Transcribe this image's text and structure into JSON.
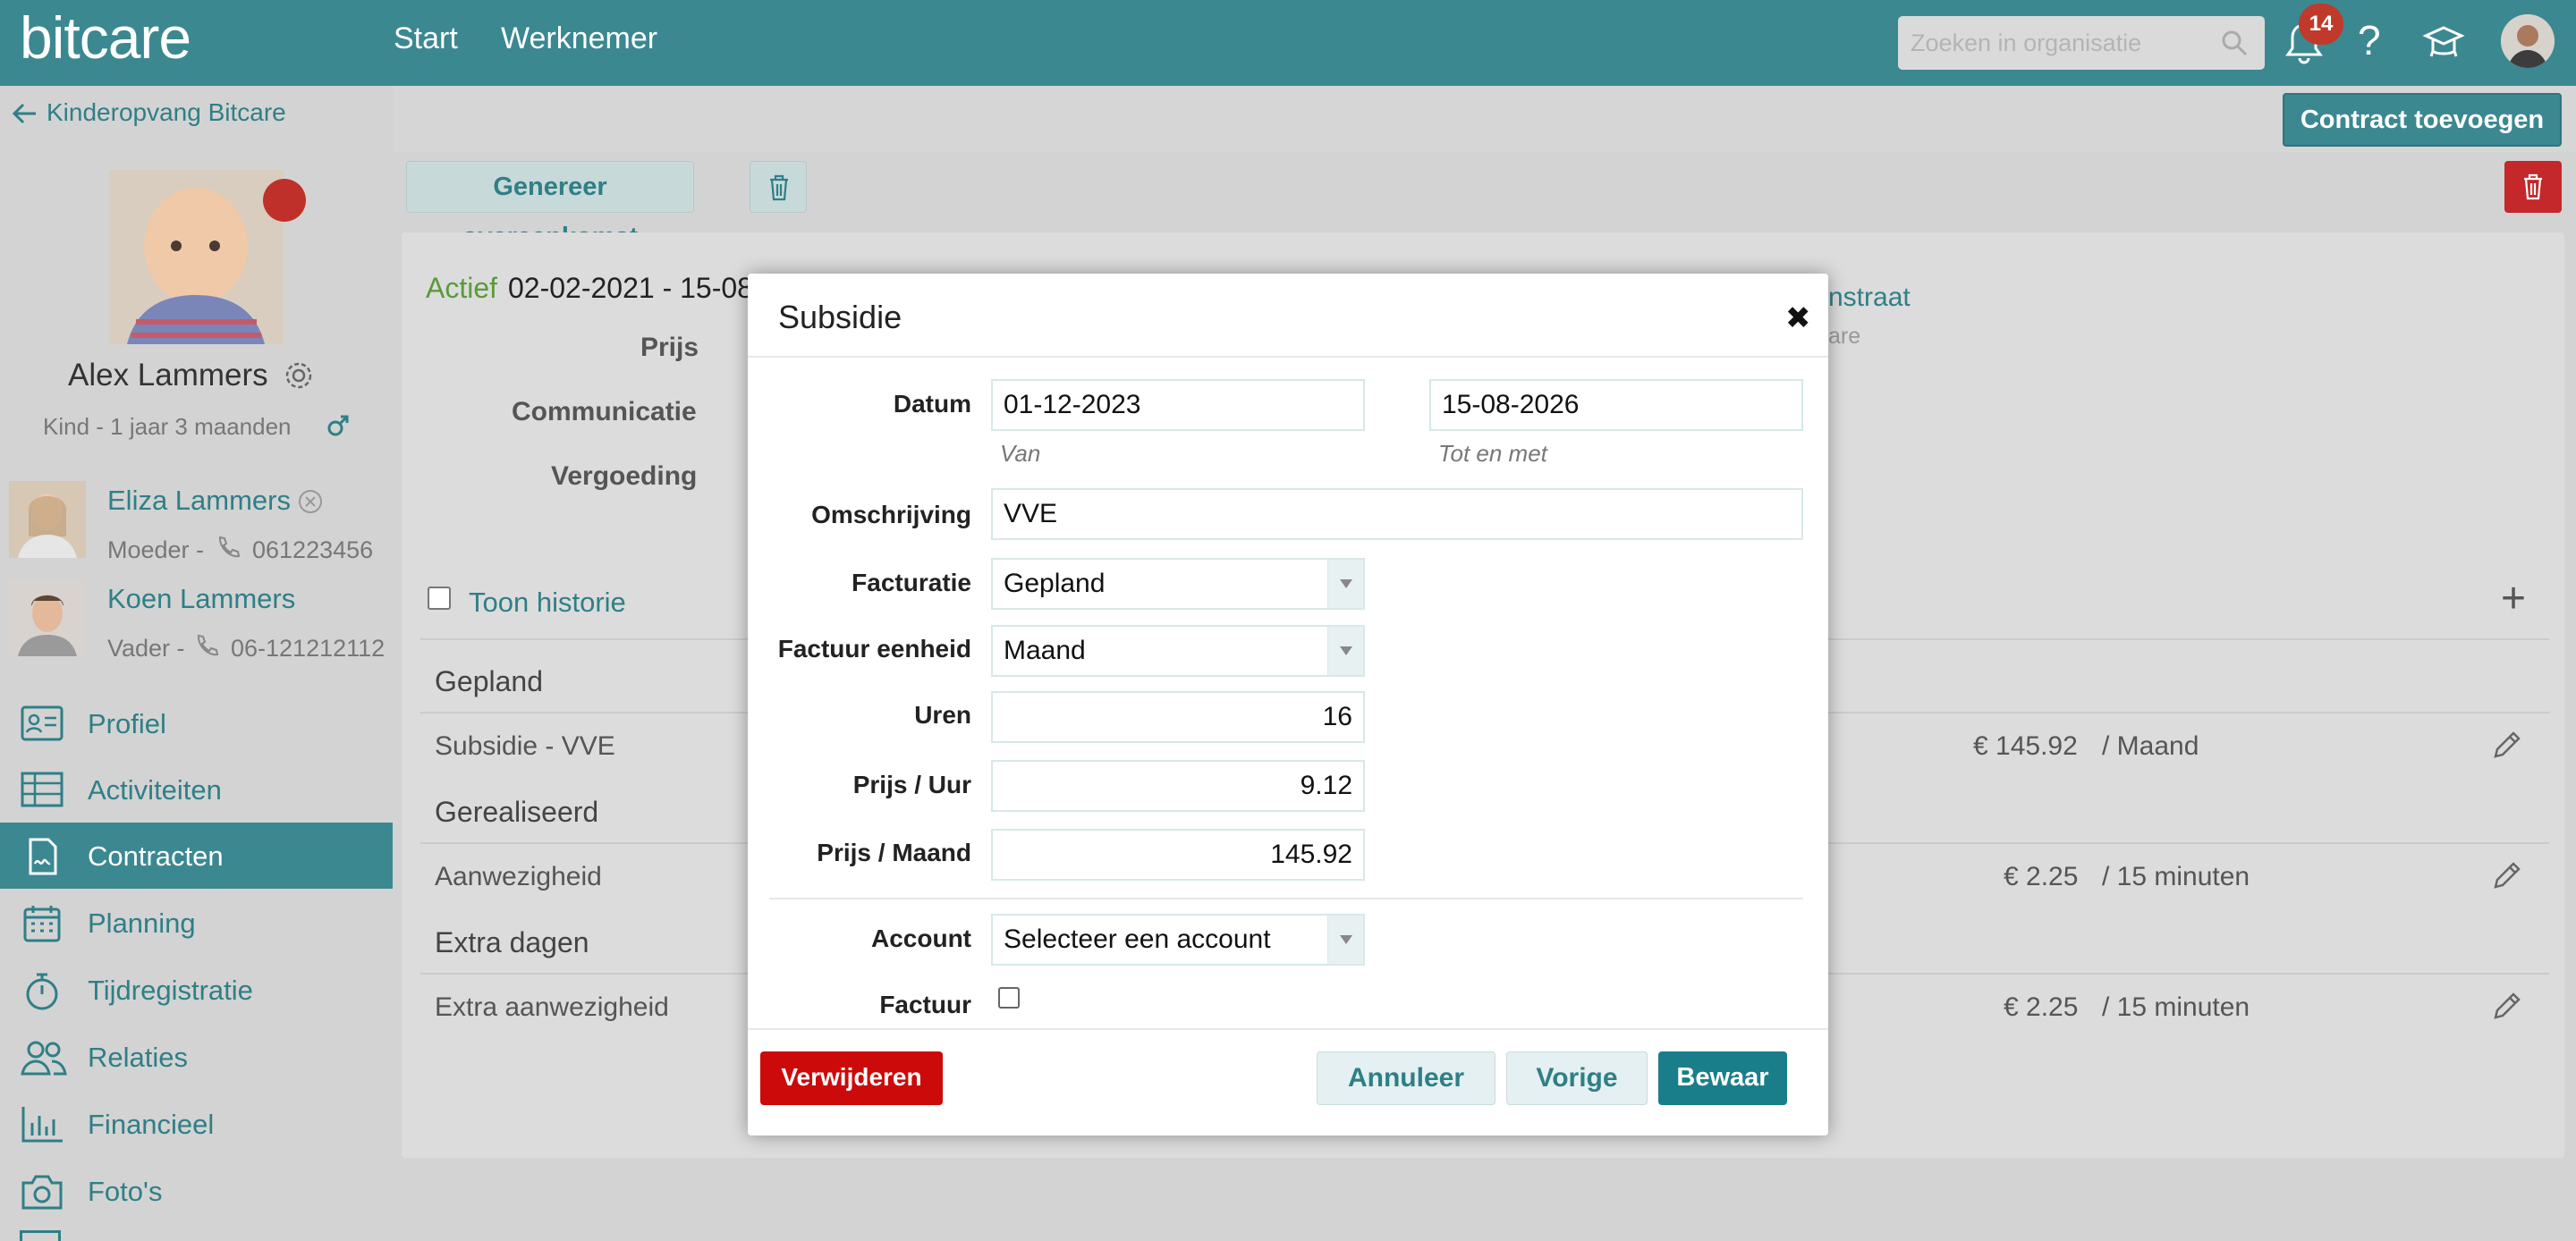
{
  "topbar": {
    "logo": "bitcare",
    "nav": [
      "Start",
      "Werknemer"
    ],
    "search_placeholder": "Zoeken in organisatie",
    "notification_count": "14",
    "help": "?"
  },
  "sidebar": {
    "back_label": "Kinderopvang Bitcare",
    "child": {
      "name": "Alex Lammers",
      "sub": "Kind - 1 jaar 3 maanden"
    },
    "relations": [
      {
        "name": "Eliza Lammers",
        "role": "Moeder -",
        "phone": "061223456"
      },
      {
        "name": "Koen Lammers",
        "role": "Vader -",
        "phone": "06-121212112"
      }
    ],
    "menu": [
      {
        "label": "Profiel",
        "icon": "profile-card-icon"
      },
      {
        "label": "Activiteiten",
        "icon": "table-icon"
      },
      {
        "label": "Contracten",
        "icon": "contract-icon",
        "active": true
      },
      {
        "label": "Planning",
        "icon": "calendar-icon"
      },
      {
        "label": "Tijdregistratie",
        "icon": "stopwatch-icon"
      },
      {
        "label": "Relaties",
        "icon": "people-icon"
      },
      {
        "label": "Financieel",
        "icon": "bar-chart-icon"
      },
      {
        "label": "Foto's",
        "icon": "camera-icon"
      }
    ]
  },
  "main": {
    "add_contract_label": "Contract toevoegen",
    "generate_label": "Genereer overeenkomst",
    "contract": {
      "status": "Actief",
      "period": "02-02-2021 - 15-08",
      "labels": [
        "Prijs",
        "Communicatie",
        "Vergoeding"
      ],
      "address_fragment": "nstraat",
      "address_sub": "are"
    },
    "history_label": "Toon historie",
    "sections": [
      {
        "title": "Gepland",
        "rows": [
          {
            "name": "Subsidie - VVE",
            "price": "€ 145.92",
            "unit": "/ Maand"
          }
        ]
      },
      {
        "title": "Gerealiseerd",
        "rows": [
          {
            "name": "Aanwezigheid",
            "price": "€ 2.25",
            "unit": "/ 15 minuten"
          }
        ]
      },
      {
        "title": "Extra dagen",
        "rows": [
          {
            "name": "Extra aanwezigheid",
            "price": "€ 2.25",
            "unit": "/ 15 minuten"
          }
        ]
      }
    ]
  },
  "modal": {
    "title": "Subsidie",
    "close": "✖",
    "fields": {
      "datum_label": "Datum",
      "datum_from": "01-12-2023",
      "datum_to": "15-08-2026",
      "from_hint": "Van",
      "to_hint": "Tot en met",
      "omschrijving_label": "Omschrijving",
      "omschrijving": "VVE",
      "facturatie_label": "Facturatie",
      "facturatie": "Gepland",
      "factuur_eenheid_label": "Factuur eenheid",
      "factuur_eenheid": "Maand",
      "uren_label": "Uren",
      "uren": "16",
      "prijs_uur_label": "Prijs / Uur",
      "prijs_uur": "9.12",
      "prijs_maand_label": "Prijs / Maand",
      "prijs_maand": "145.92",
      "account_label": "Account",
      "account": "Selecteer een account",
      "factuur_label": "Factuur"
    },
    "buttons": {
      "delete": "Verwijderen",
      "cancel": "Annuleer",
      "previous": "Vorige",
      "save": "Bewaar"
    }
  },
  "colors": {
    "brand": "#3b8891",
    "link": "#2f7f87",
    "danger": "#c4282a",
    "active_green": "#5a9a3c"
  }
}
